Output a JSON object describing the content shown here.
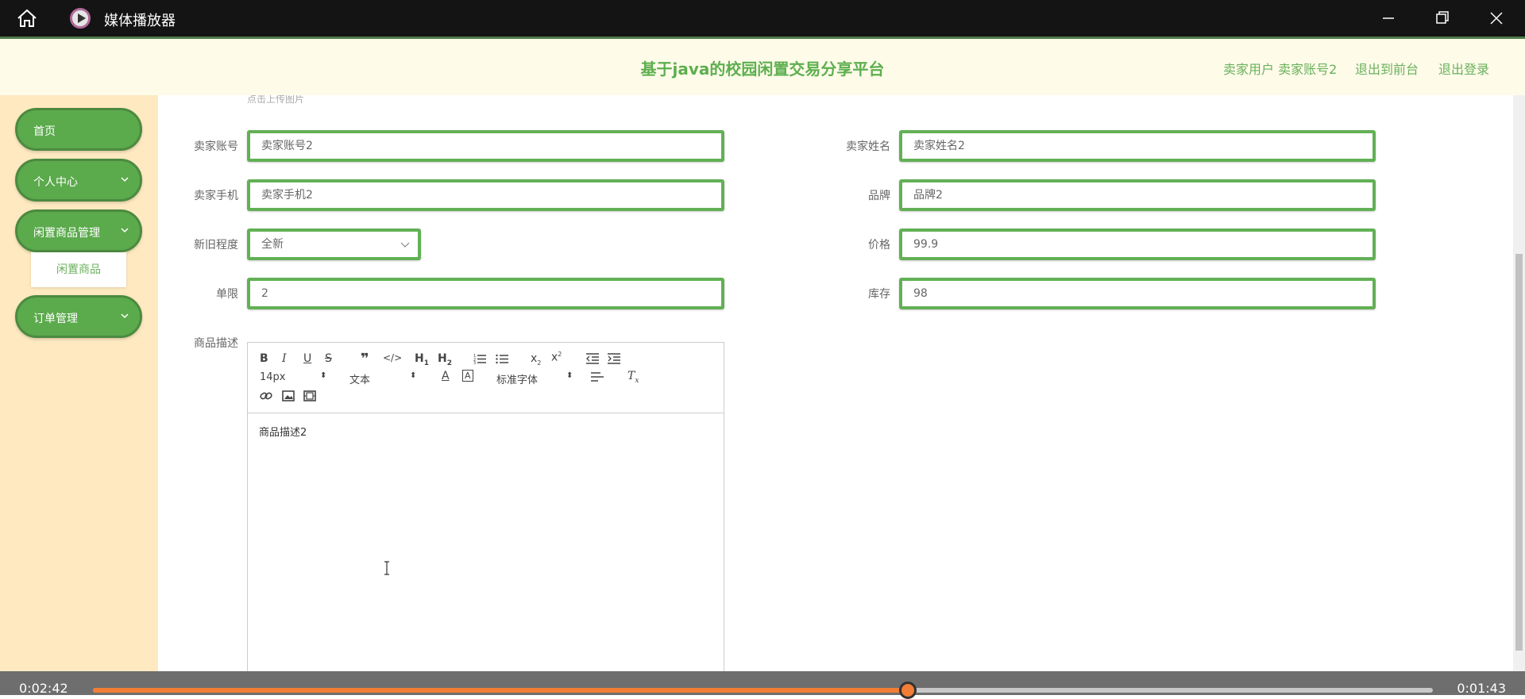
{
  "window": {
    "title": "媒体播放器"
  },
  "header": {
    "title": "基于java的校园闲置交易分享平台",
    "user_label": "卖家用户 卖家账号2",
    "to_front": "退出到前台",
    "logout": "退出登录"
  },
  "sidebar": {
    "items": [
      {
        "label": "首页"
      },
      {
        "label": "个人中心"
      },
      {
        "label": "闲置商品管理"
      },
      {
        "label": "订单管理"
      }
    ],
    "sub_item": "闲置商品"
  },
  "form": {
    "hint": "点击上传图片",
    "seller_account": {
      "label": "卖家账号",
      "value": "卖家账号2"
    },
    "seller_name": {
      "label": "卖家姓名",
      "value": "卖家姓名2"
    },
    "seller_phone": {
      "label": "卖家手机",
      "value": "卖家手机2"
    },
    "brand": {
      "label": "品牌",
      "value": "品牌2"
    },
    "condition": {
      "label": "新旧程度",
      "value": "全新"
    },
    "price": {
      "label": "价格",
      "value": "99.9"
    },
    "limit": {
      "label": "单限",
      "value": "2"
    },
    "stock": {
      "label": "库存",
      "value": "98"
    },
    "description": {
      "label": "商品描述",
      "value": "商品描述2"
    }
  },
  "editor": {
    "font_size": "14px",
    "block_type": "文本",
    "font_family": "标准字体"
  },
  "player": {
    "elapsed": "0:02:42",
    "remaining": "0:01:43",
    "progress": 0.608
  }
}
